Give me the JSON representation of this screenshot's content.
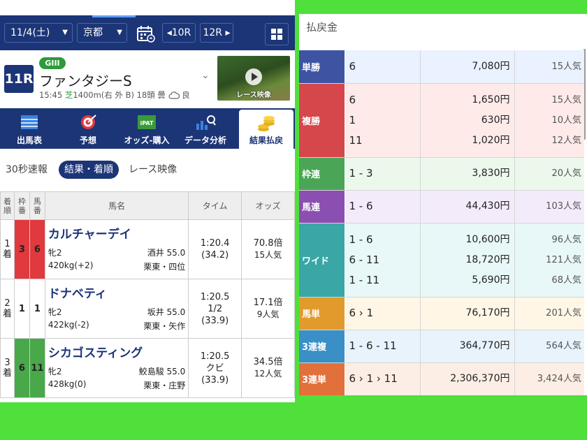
{
  "nav": {
    "date": "11/4(土)",
    "venue": "京都",
    "prev_race": "◂10R",
    "next_race": "12R ▸"
  },
  "race": {
    "number": "11R",
    "grade": "GIII",
    "name": "ファンタジーS",
    "time": "15:45",
    "surface": "芝",
    "course": "1400m(右 外 B)",
    "heads": "18頭",
    "weather": "曇",
    "condition": "良",
    "video_label": "レース映像"
  },
  "menu": {
    "items": [
      {
        "label": "出馬表",
        "icon": "entry-list-icon"
      },
      {
        "label": "予想",
        "icon": "target-icon"
      },
      {
        "label": "オッズ-購入",
        "icon": "ipat-icon"
      },
      {
        "label": "データ分析",
        "icon": "chart-search-icon"
      },
      {
        "label": "結果払戻",
        "icon": "coins-icon"
      }
    ],
    "active_index": 4
  },
  "subtabs": {
    "items": [
      "30秒速報",
      "結果・着順",
      "レース映像"
    ],
    "active_index": 1
  },
  "results": {
    "headers": {
      "rank": "着順",
      "waku": "枠番",
      "uma": "馬番",
      "horse": "馬名",
      "time": "タイム",
      "odds": "オッズ"
    },
    "rows": [
      {
        "rank": "1着",
        "waku": "3",
        "uma": "6",
        "waku_color": "#e0393e",
        "name": "カルチャーデイ",
        "sex_age": "牝2",
        "jockey": "酒井 55.0",
        "weight": "420kg(+2)",
        "trainer": "栗東・四位",
        "time": "1:20.4",
        "diff": "",
        "last3f": "(34.2)",
        "odds": "70.8倍",
        "pop": "15人気"
      },
      {
        "rank": "2着",
        "waku": "1",
        "uma": "1",
        "waku_color": "#ffffff",
        "name": "ドナベティ",
        "sex_age": "牝2",
        "jockey": "坂井 55.0",
        "weight": "422kg(-2)",
        "trainer": "栗東・矢作",
        "time": "1:20.5",
        "diff": "1/2",
        "last3f": "(33.9)",
        "odds": "17.1倍",
        "pop": "9人気"
      },
      {
        "rank": "3着",
        "waku": "6",
        "uma": "11",
        "waku_color": "#49a84a",
        "name": "シカゴスティング",
        "sex_age": "牝2",
        "jockey": "鮫島駿 55.0",
        "weight": "428kg(0)",
        "trainer": "栗東・庄野",
        "time": "1:20.5",
        "diff": "クビ",
        "last3f": "(33.9)",
        "odds": "34.5倍",
        "pop": "12人気"
      }
    ]
  },
  "payout": {
    "title": "払戻金",
    "rows": [
      {
        "type": "単勝",
        "color": "#3e54a3",
        "bg": "#eaf1ff",
        "entries": [
          {
            "combo": "6",
            "amount": "7,080円",
            "pop": "15人気"
          }
        ]
      },
      {
        "type": "複勝",
        "color": "#d5474b",
        "bg": "#ffeaea",
        "entries": [
          {
            "combo": "6",
            "amount": "1,650円",
            "pop": "15人気"
          },
          {
            "combo": "1",
            "amount": "630円",
            "pop": "10人気"
          },
          {
            "combo": "11",
            "amount": "1,020円",
            "pop": "12人気"
          }
        ]
      },
      {
        "type": "枠連",
        "color": "#4aa556",
        "bg": "#ecf8ec",
        "entries": [
          {
            "combo": "1 - 3",
            "amount": "3,830円",
            "pop": "20人気"
          }
        ]
      },
      {
        "type": "馬連",
        "color": "#8a4fb0",
        "bg": "#f4ebfa",
        "entries": [
          {
            "combo": "1 - 6",
            "amount": "44,430円",
            "pop": "103人気"
          }
        ]
      },
      {
        "type": "ワイド",
        "color": "#3aa6a6",
        "bg": "#e8f7f7",
        "entries": [
          {
            "combo": "1 - 6",
            "amount": "10,600円",
            "pop": "96人気"
          },
          {
            "combo": "6 - 11",
            "amount": "18,720円",
            "pop": "121人気"
          },
          {
            "combo": "1 - 11",
            "amount": "5,690円",
            "pop": "68人気"
          }
        ]
      },
      {
        "type": "馬単",
        "color": "#e29a2c",
        "bg": "#fff6e6",
        "entries": [
          {
            "combo": "6 › 1",
            "amount": "76,170円",
            "pop": "201人気"
          }
        ]
      },
      {
        "type": "3連複",
        "color": "#3a8fc7",
        "bg": "#e8f3fb",
        "entries": [
          {
            "combo": "1 - 6 - 11",
            "amount": "364,770円",
            "pop": "564人気"
          }
        ]
      },
      {
        "type": "3連単",
        "color": "#e2703a",
        "bg": "#fdeee5",
        "entries": [
          {
            "combo": "6 › 1 › 11",
            "amount": "2,306,370円",
            "pop": "3,424人気"
          }
        ]
      }
    ]
  }
}
